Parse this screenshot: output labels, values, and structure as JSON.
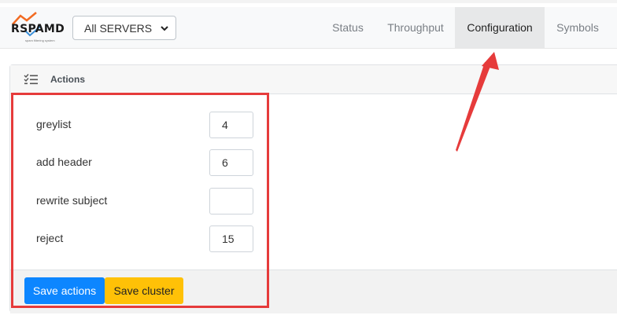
{
  "app": {
    "logo_text": "RSPAMD",
    "logo_tagline": "spam filtering system",
    "colors": {
      "logo_orange": "#f26b22",
      "logo_blue": "#3a8fd8"
    }
  },
  "server_select": {
    "value": "All SERVERS",
    "icon": "chevron-down-icon"
  },
  "nav": {
    "tabs": [
      {
        "label": "Status"
      },
      {
        "label": "Throughput"
      },
      {
        "label": "Configuration",
        "active": true
      },
      {
        "label": "Symbols"
      }
    ]
  },
  "actions_panel": {
    "title": "Actions",
    "icon": "list-check-icon",
    "rows": [
      {
        "label": "greylist",
        "value": "4"
      },
      {
        "label": "add header",
        "value": "6"
      },
      {
        "label": "rewrite subject",
        "value": ""
      },
      {
        "label": "reject",
        "value": "15"
      }
    ],
    "buttons": {
      "save_actions": "Save actions",
      "save_cluster": "Save cluster"
    }
  },
  "colors": {
    "primary": "#0d86ff",
    "warning": "#ffc107",
    "annotation": "#e63b3b"
  }
}
